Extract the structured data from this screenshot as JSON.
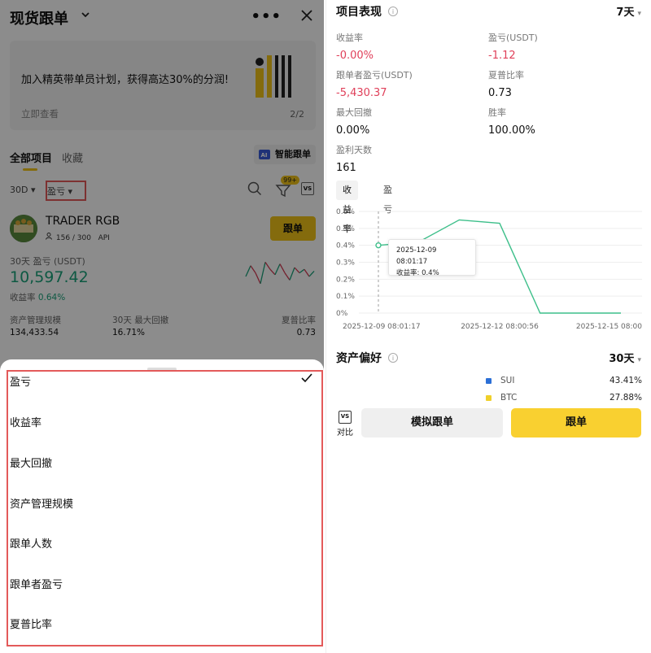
{
  "left": {
    "header": {
      "title": "现货跟单",
      "more_label": "•••"
    },
    "banner": {
      "text": "加入精英带单员计划，获得高达30%的分润!",
      "link": "立即查看",
      "pager": "2/2"
    },
    "tabs": {
      "all": "全部项目",
      "favorites": "收藏",
      "smart": "智能跟单"
    },
    "filters": {
      "period": "30D ▾",
      "sort": "盈亏 ▾",
      "badge": "99+",
      "vs": "VS"
    },
    "trader": {
      "name": "TRADER RGB",
      "followers": "156 / 300",
      "api": "API",
      "follow_btn": "跟单",
      "pnl_label": "30天 盈亏 (USDT)",
      "pnl_value": "10,597.42",
      "roi_label": "收益率",
      "roi_value": "0.64%",
      "stats": [
        {
          "label": "资产管理规模",
          "value": "134,433.54"
        },
        {
          "label": "30天 最大回撤",
          "value": "16.71%"
        },
        {
          "label": "夏普比率",
          "value": "0.73"
        }
      ]
    },
    "sort_sheet": {
      "options": [
        "盈亏",
        "收益率",
        "最大回撤",
        "资产管理规模",
        "跟单人数",
        "跟单者盈亏",
        "夏普比率"
      ],
      "selected_index": 0
    }
  },
  "right": {
    "performance": {
      "title": "项目表现",
      "period": "7天",
      "metrics": [
        {
          "label": "收益率",
          "value": "-0.00%",
          "color": "#e0405a"
        },
        {
          "label": "盈亏(USDT)",
          "value": "-1.12",
          "color": "#e0405a"
        },
        {
          "label": "跟单者盈亏(USDT)",
          "value": "-5,430.37",
          "color": "#e0405a"
        },
        {
          "label": "夏普比率",
          "value": "0.73",
          "color": "#111111"
        },
        {
          "label": "最大回撤",
          "value": "0.00%",
          "color": "#111111"
        },
        {
          "label": "胜率",
          "value": "100.00%",
          "color": "#111111"
        },
        {
          "label": "盈利天数",
          "value": "161",
          "color": "#111111"
        }
      ]
    },
    "chart_tabs": {
      "roi": "收益率",
      "pnl": "盈亏"
    },
    "tooltip": {
      "date": "2025-12-09 08:01:17",
      "value_line": "收益率: 0.4%"
    },
    "assets": {
      "title": "资产偏好",
      "period": "30天",
      "items": [
        {
          "name": "SUI",
          "pct": "43.41%",
          "color": "#2b6fd6"
        },
        {
          "name": "BTC",
          "pct": "27.88%",
          "color": "#f0d02a"
        }
      ]
    },
    "actions": {
      "compare": "对比",
      "vs": "VS",
      "simulate": "模拟跟单",
      "follow": "跟单"
    }
  },
  "chart_data": {
    "type": "line",
    "title": "",
    "xlabel": "",
    "ylabel": "",
    "x": [
      "2025-12-09 08:01:17",
      "2025-12-10",
      "2025-12-11",
      "2025-12-12 08:00:56",
      "2025-12-13",
      "2025-12-14",
      "2025-12-15 08:00"
    ],
    "y": [
      0.4,
      0.42,
      0.55,
      0.53,
      0.0,
      0.0,
      0.0
    ],
    "x_tick_labels": [
      "2025-12-09 08:01:17",
      "2025-12-12 08:00:56",
      "2025-12-15 08:00"
    ],
    "y_tick_labels": [
      "0%",
      "0.1%",
      "0.2%",
      "0.3%",
      "0.4%",
      "0.5%",
      "0.6%"
    ],
    "ylim": [
      0,
      0.6
    ],
    "grid": true,
    "line_color": "#3dbf8a",
    "grid_color": "#eeeeee",
    "tooltip_color": "#888888"
  },
  "spark_data": {
    "y": [
      0.5,
      0.8,
      0.6,
      0.3,
      0.9,
      0.7,
      0.55,
      0.85,
      0.6,
      0.4,
      0.75,
      0.6,
      0.7,
      0.5,
      0.65
    ],
    "colors": {
      "up": "#1aa27a",
      "down": "#d43a52"
    }
  }
}
